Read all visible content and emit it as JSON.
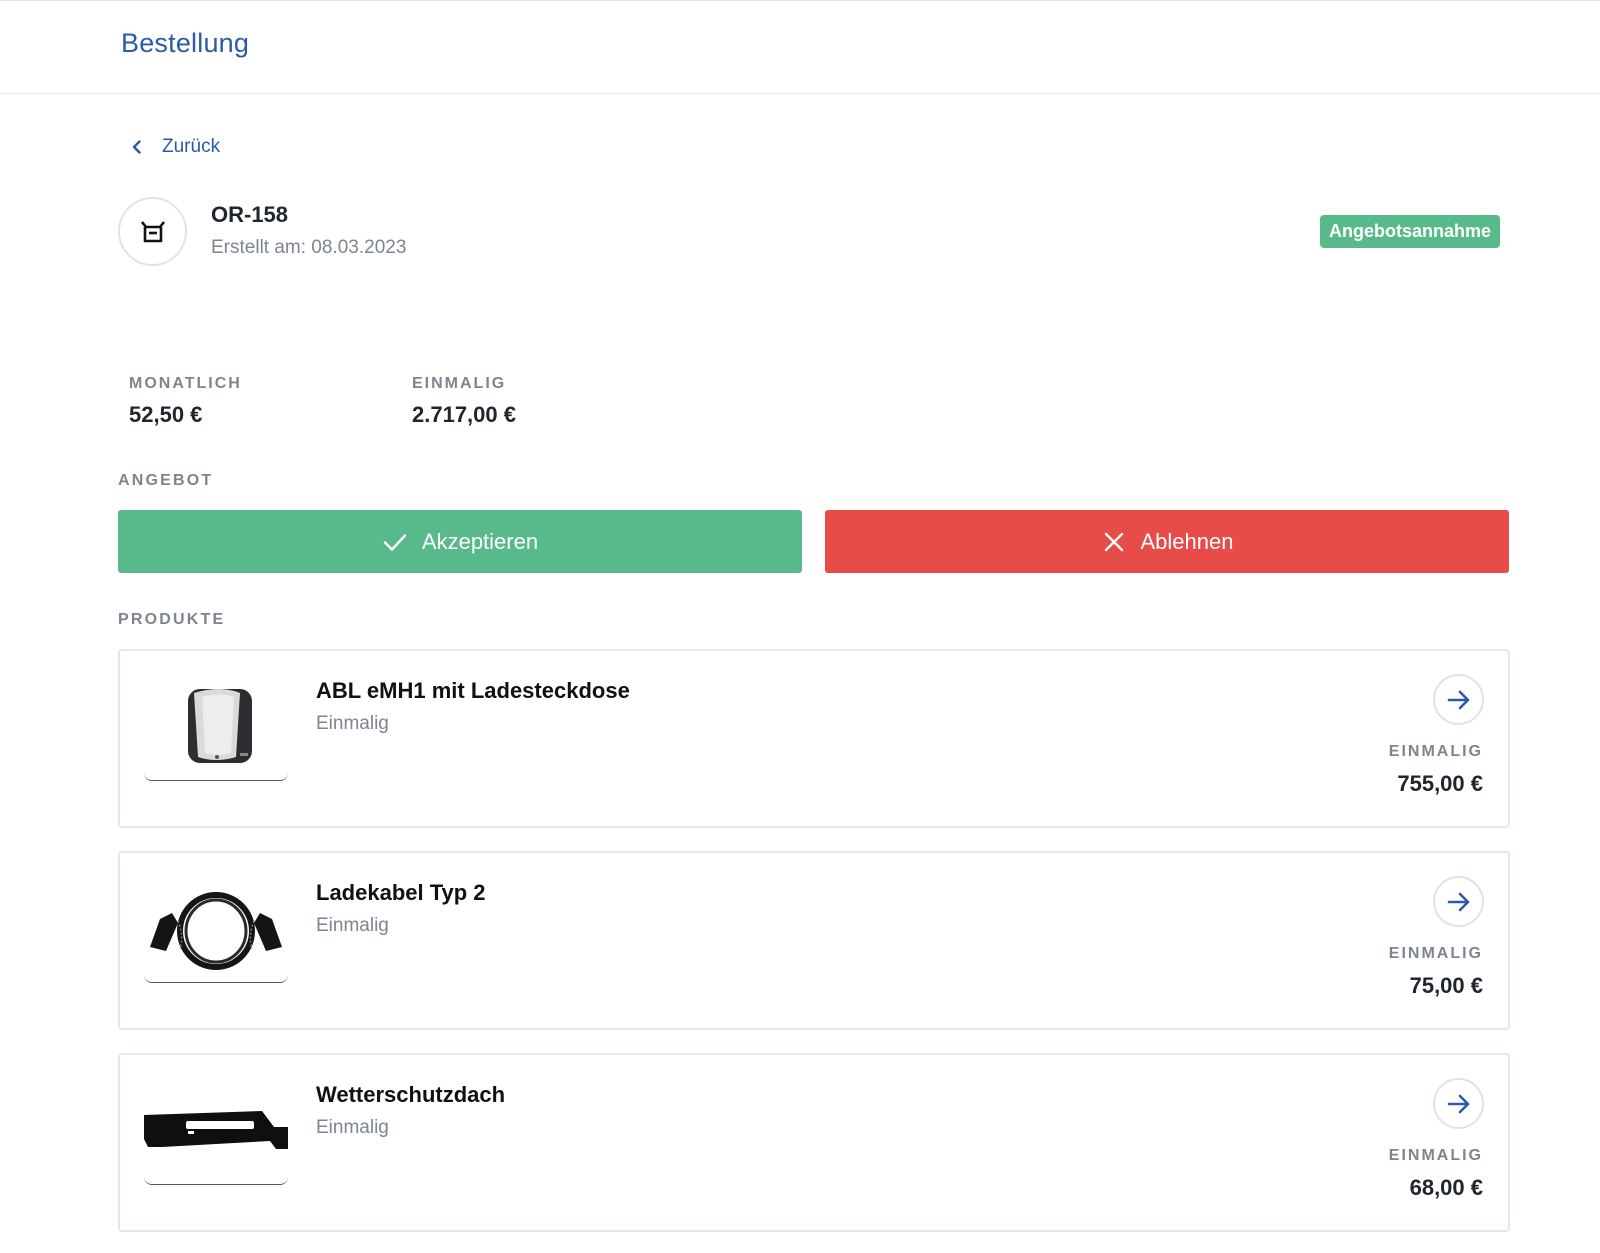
{
  "header": {
    "title": "Bestellung"
  },
  "back": {
    "label": "Zurück"
  },
  "order": {
    "id": "OR-158",
    "created": "Erstellt am: 08.03.2023",
    "status": "Angebotsannahme"
  },
  "summary": {
    "monthly_label": "MONATLICH",
    "monthly_value": "52,50 €",
    "once_label": "EINMALIG",
    "once_value": "2.717,00 €"
  },
  "offer": {
    "section_label": "ANGEBOT",
    "accept_label": "Akzeptieren",
    "decline_label": "Ablehnen"
  },
  "products": {
    "section_label": "PRODUKTE",
    "items": [
      {
        "name": "ABL eMH1 mit Ladesteckdose",
        "type": "Einmalig",
        "price_label": "EINMALIG",
        "price": "755,00 €",
        "image": "wallbox-image"
      },
      {
        "name": "Ladekabel Typ 2",
        "type": "Einmalig",
        "price_label": "EINMALIG",
        "price": "75,00 €",
        "image": "charging-cable-image"
      },
      {
        "name": "Wetterschutzdach",
        "type": "Einmalig",
        "price_label": "EINMALIG",
        "price": "68,00 €",
        "image": "weather-roof-image"
      }
    ]
  },
  "colors": {
    "accent": "#2a5ba6",
    "success": "#58b98a",
    "danger": "#e84c49",
    "muted": "#7e8590"
  }
}
